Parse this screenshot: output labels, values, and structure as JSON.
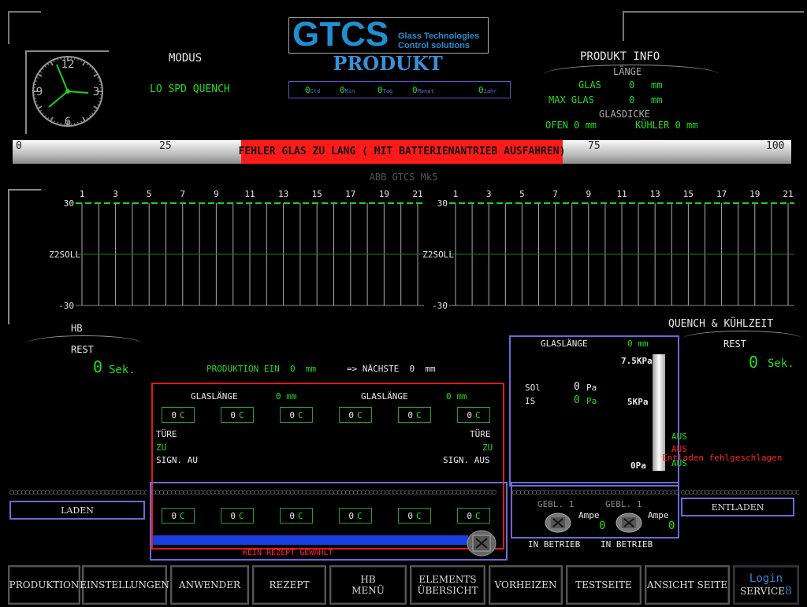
{
  "logo": {
    "brand": "GTCS",
    "line1": "Glass Technologies",
    "line2": "Control solutions"
  },
  "page_title": "PRODUKT",
  "modus": {
    "label": "MODUS",
    "value": "LO SPD QUENCH"
  },
  "clock": {
    "n12": "12",
    "n3": "3",
    "n6": "6",
    "n9": "9"
  },
  "time_counters": [
    {
      "value": "0",
      "unit": "Std"
    },
    {
      "value": "0",
      "unit": "Min"
    },
    {
      "value": "0",
      "unit": "Tag"
    },
    {
      "value": "0",
      "unit": "Monat"
    },
    {
      "value": "0",
      "unit": "Jahr"
    }
  ],
  "produkt_info": {
    "title": "PRODUKT INFO",
    "laenge": "LÄNGE",
    "glas_label": "GLAS",
    "glas_value": "0",
    "glas_unit": "mm",
    "max_glas_label": "MAX GLAS",
    "max_glas_value": "0",
    "max_glas_unit": "mm",
    "glasdicke": "GLASDICKE",
    "ofen": "OFEN 0 mm",
    "kuehler": "KÜHLER 0 mm"
  },
  "progress": {
    "ticks": [
      "0",
      "25",
      "75",
      "100"
    ],
    "alarm": "FEHLER GLAS ZU LANG ( MIT BATTERIENANTRIEB AUSFAHREN)",
    "level": 0
  },
  "footer_model": "ABB GTCS Mk5",
  "chart_data": [
    {
      "type": "line",
      "categories": [
        "1",
        "3",
        "5",
        "7",
        "9",
        "11",
        "13",
        "15",
        "17",
        "19",
        "21"
      ],
      "series": [],
      "ylabels": [
        "30",
        "Z2SOLL",
        "-30"
      ],
      "ylim": [
        -30,
        30
      ],
      "grid": true
    },
    {
      "type": "line",
      "categories": [
        "1",
        "3",
        "5",
        "7",
        "9",
        "11",
        "13",
        "15",
        "17",
        "19",
        "21"
      ],
      "series": [],
      "ylabels": [
        "30",
        "Z2SOLL",
        "-30"
      ],
      "ylim": [
        -30,
        30
      ],
      "grid": true
    }
  ],
  "hb": {
    "label": "HB",
    "rest_label": "REST",
    "rest_value": "0",
    "rest_unit": "Sek."
  },
  "quench": {
    "label": "QUENCH & KÜHLZEIT",
    "rest_label": "REST",
    "rest_value": "0",
    "rest_unit": "Sek."
  },
  "produktion": {
    "text": "PRODUKTION EIN  0  mm",
    "next": "=> NÄCHSTE  0  mm"
  },
  "furnace": {
    "glaslaenge_label": "GLASLÄNGE",
    "glaslaenge_value": "0 mm",
    "glaslaenge2_label": "GLASLÄNGE",
    "glaslaenge2_value": "0 mm",
    "top_temps": [
      {
        "v": "0",
        "u": "C"
      },
      {
        "v": "0",
        "u": "C"
      },
      {
        "v": "0",
        "u": "C"
      },
      {
        "v": "0",
        "u": "C"
      },
      {
        "v": "0",
        "u": "C"
      },
      {
        "v": "0",
        "u": "C"
      }
    ],
    "bottom_temps": [
      {
        "v": "0",
        "u": "C"
      },
      {
        "v": "0",
        "u": "C"
      },
      {
        "v": "0",
        "u": "C"
      },
      {
        "v": "0",
        "u": "C"
      },
      {
        "v": "0",
        "u": "C"
      },
      {
        "v": "0",
        "u": "C"
      }
    ],
    "left": {
      "tuere": "TÜRE",
      "zu": "ZU",
      "sign": "SIGN. AU"
    },
    "right": {
      "tuere": "TÜRE",
      "zu": "ZU",
      "sign": "SIGN. AUS"
    },
    "status": "KEIN REZEPT GEWÄHLT"
  },
  "quench_panel": {
    "glaslaenge_label": "GLASLÄNGE",
    "glaslaenge_value": "0 mm",
    "p_max": "7.5KPa",
    "p_mid": "5KPa",
    "p_min": "0Pa",
    "soll_label": "SOl",
    "soll_value": "0",
    "soll_unit": "Pa",
    "ist_label": "IS",
    "ist_value": "0",
    "ist_unit": "Pa",
    "aus1": "AUS",
    "aus2": "AUS",
    "aus3": "AUS",
    "entladen_error": "Entladen fehlgeschlagen"
  },
  "blowers": {
    "gebl1": "GEBL. 1",
    "gebl2": "GEBL. 1",
    "ampe1": "Ampe",
    "ampe2": "Ampe",
    "amp1_value": "0",
    "amp2_value": "0",
    "status1": "IN BETRIEB",
    "status2": "IN BETRIEB"
  },
  "laden": "LADEN",
  "entladen": "ENTLADEN",
  "nav": [
    "PRODUKTION",
    "EINSTELLUNGEN",
    "ANWENDER",
    "REZEPT",
    "HB MENÜ",
    "ELEMENTS ÜBERSICHT",
    "VORHEIZEN",
    "TESTSEITE",
    "ANSICHT SEITE"
  ],
  "login": {
    "label": "Login",
    "service": "SERVICE",
    "level": "8"
  },
  "colors": {
    "green": "#22dd22",
    "red": "#ff2222",
    "blue": "#6a6ad8",
    "logo_blue": "#1f8fd0"
  }
}
